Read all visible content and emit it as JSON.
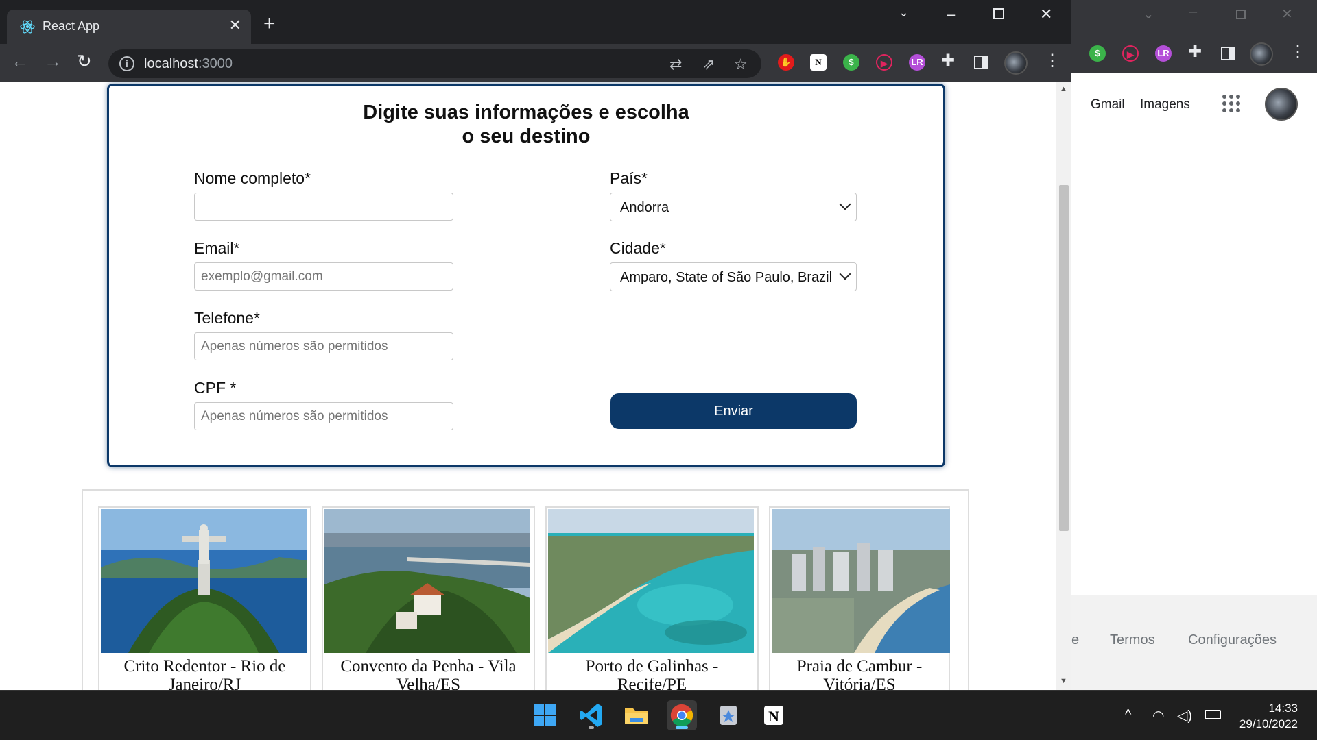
{
  "browser": {
    "tab_title": "React App",
    "url_host": "localhost",
    "url_port": ":3000"
  },
  "form": {
    "title_line1": "Digite suas informações e escolha",
    "title_line2": "o seu destino",
    "name_label": "Nome completo*",
    "name_value": "",
    "email_label": "Email*",
    "email_placeholder": "exemplo@gmail.com",
    "phone_label": "Telefone*",
    "phone_placeholder": "Apenas números são permitidos",
    "cpf_label": "CPF *",
    "cpf_placeholder": "Apenas números são permitidos",
    "country_label": "País*",
    "country_value": "Andorra",
    "city_label": "Cidade*",
    "city_value": "Amparo, State of São Paulo, Brazil",
    "submit_label": "Enviar"
  },
  "gallery": [
    {
      "caption": "Crito Redentor - Rio de Janeiro/RJ"
    },
    {
      "caption": "Convento da Penha - Vila Velha/ES"
    },
    {
      "caption": "Porto de Galinhas - Recife/PE"
    },
    {
      "caption": "Praia de Cambur - Vitória/ES"
    }
  ],
  "side_window": {
    "gmail": "Gmail",
    "images": "Imagens",
    "footer_partial": "e",
    "terms": "Termos",
    "settings": "Configurações"
  },
  "taskbar": {
    "time": "14:33",
    "date": "29/10/2022"
  },
  "colors": {
    "brand": "#0c3868",
    "chrome_dark": "#202124",
    "chrome_toolbar": "#35363a"
  }
}
